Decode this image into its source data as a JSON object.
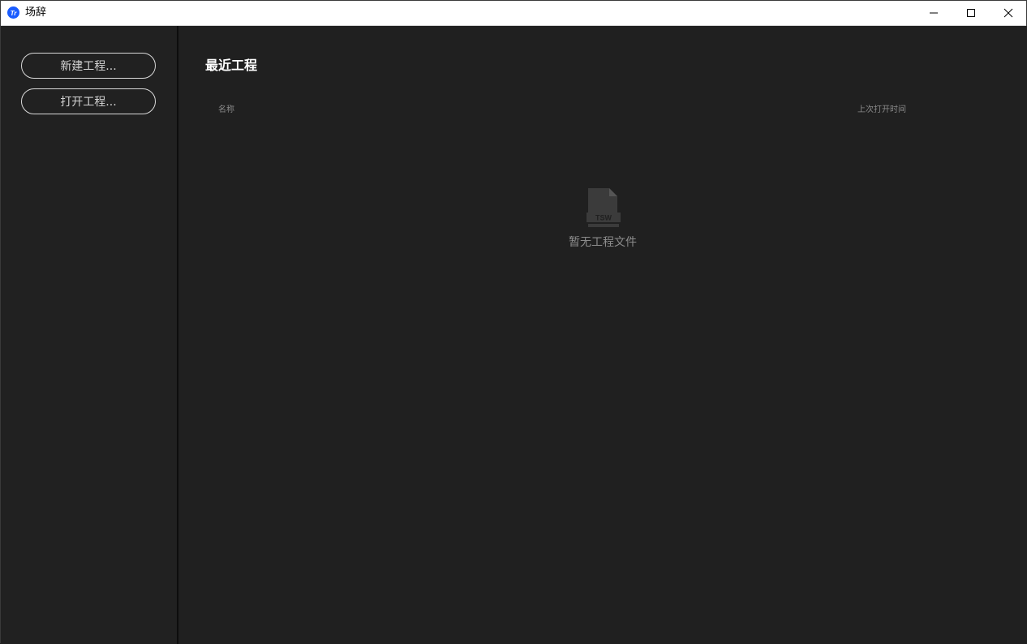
{
  "window": {
    "title": "场辞",
    "controls": {
      "minimize": "minimize-icon",
      "maximize": "maximize-icon",
      "close": "close-icon"
    }
  },
  "sidebar": {
    "new_project_label": "新建工程...",
    "open_project_label": "打开工程..."
  },
  "main": {
    "section_title": "最近工程",
    "columns": {
      "name": "名称",
      "last_opened": "上次打开时间"
    },
    "empty_state": {
      "icon_label": "TSW",
      "message": "暂无工程文件"
    }
  },
  "colors": {
    "background": "#202020",
    "sidebar_background": "#212121",
    "accent": "#1a5cff",
    "title_bar": "#ffffff"
  }
}
